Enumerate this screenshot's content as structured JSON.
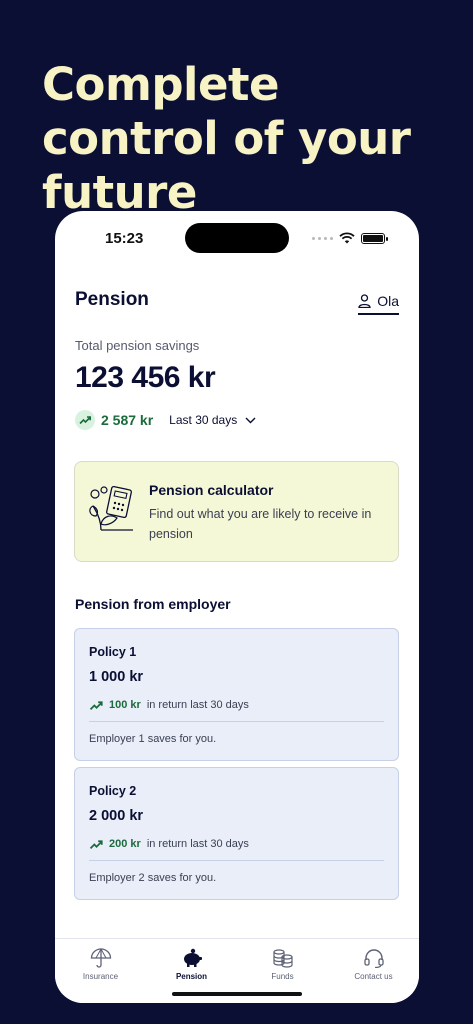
{
  "headline": "Complete control of your future",
  "status_bar": {
    "time": "15:23"
  },
  "header": {
    "title": "Pension",
    "user_name": "Ola"
  },
  "summary": {
    "label": "Total pension savings",
    "amount": "123 456 kr",
    "change": "2 587 kr",
    "period": "Last 30 days"
  },
  "calculator": {
    "title": "Pension calculator",
    "description": "Find out what you are likely to receive in pension"
  },
  "employer_section": {
    "title": "Pension from employer",
    "policies": [
      {
        "name": "Policy 1",
        "amount": "1 000 kr",
        "return_value": "100 kr",
        "return_suffix": "in return last 30 days",
        "note": "Employer 1 saves for you."
      },
      {
        "name": "Policy 2",
        "amount": "2 000 kr",
        "return_value": "200 kr",
        "return_suffix": "in return last 30 days",
        "note": "Employer 2 saves for you."
      }
    ]
  },
  "nav": [
    {
      "label": "Insurance",
      "icon": "umbrella-icon",
      "active": false
    },
    {
      "label": "Pension",
      "icon": "piggy-bank-icon",
      "active": true
    },
    {
      "label": "Funds",
      "icon": "coins-icon",
      "active": false
    },
    {
      "label": "Contact us",
      "icon": "headset-icon",
      "active": false
    }
  ],
  "colors": {
    "background": "#0b0f33",
    "headline": "#f7f3c4",
    "positive": "#1b6b3c",
    "calc_card": "#f5f8d6",
    "policy_card": "#e9eef9"
  }
}
